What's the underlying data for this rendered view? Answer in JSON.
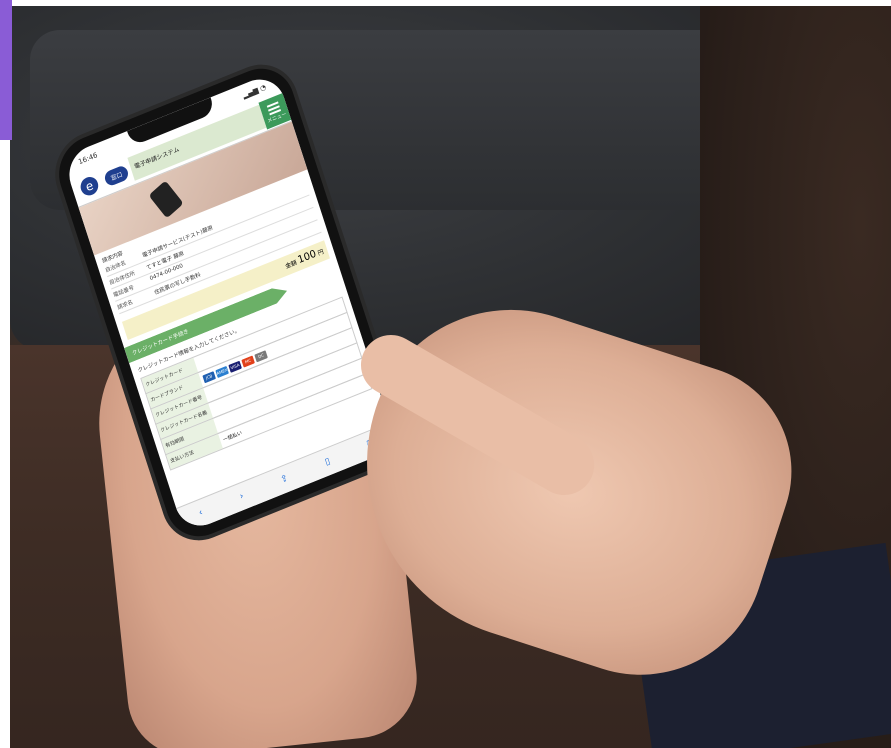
{
  "phone": {
    "time": "16:46",
    "app_title": "電子申請システム",
    "tab_label": "窓口",
    "menu_label": "メニュー",
    "logo_letter": "e",
    "details_title": "請求内容",
    "info_rows": [
      {
        "key": "自治体名",
        "value": "電子申請サービス(テスト)藤原"
      },
      {
        "key": "自治体住所",
        "value": "てすと電子 藤原"
      },
      {
        "key": "電話番号",
        "value": "0474-00-000"
      },
      {
        "key": "請求名",
        "value": "住民票の写し手数料"
      }
    ],
    "amount_label": "金額",
    "amount_value": "100",
    "amount_unit": "円",
    "section_title": "クレジットカード手続き",
    "form_note": "クレジットカード情報を入力してください。",
    "form_rows": [
      {
        "label": "クレジットカード",
        "value": ""
      },
      {
        "label": "カードブランド",
        "value": ""
      },
      {
        "label": "クレジットカード番号",
        "value": ""
      },
      {
        "label": "クレジットカード名義",
        "value": ""
      },
      {
        "label": "有効期限",
        "value": ""
      },
      {
        "label": "支払い方法",
        "value": "一括払い"
      }
    ],
    "cards": [
      {
        "name": "JCB",
        "color": "#1f5fb0"
      },
      {
        "name": "AMEX",
        "color": "#2a7fd0"
      },
      {
        "name": "VISA",
        "color": "#1a1f71"
      },
      {
        "name": "MC",
        "color": "#e2401a"
      },
      {
        "name": "DC",
        "color": "#7a7a7a"
      }
    ]
  },
  "colors": {
    "accent": "#3c9a5b",
    "brand": "#1f3f8f",
    "side_bar": "#8a5cd6"
  }
}
